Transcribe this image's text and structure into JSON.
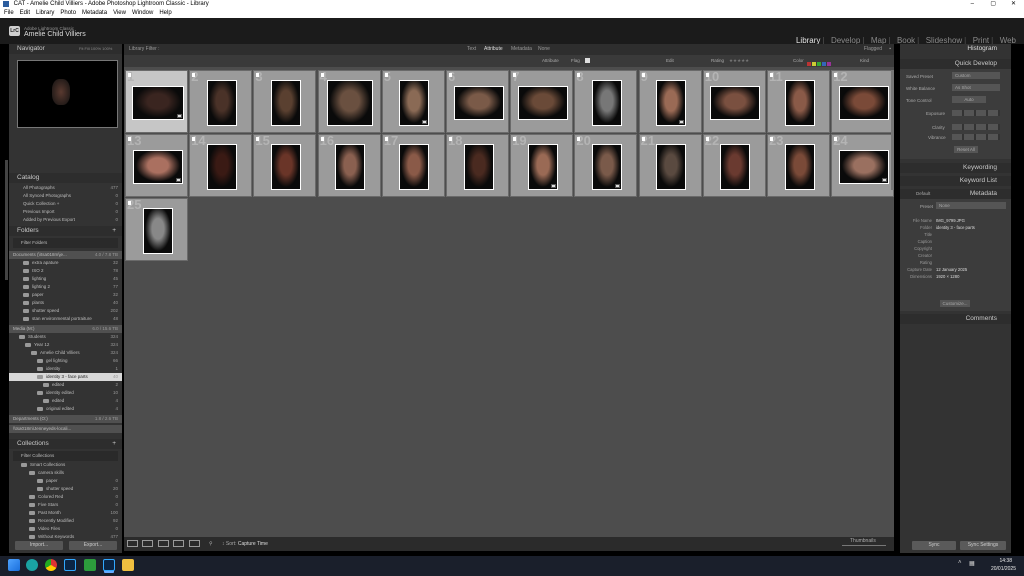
{
  "titlebar": {
    "title": "CAT - Amelie Child Villiers - Adobe Photoshop Lightroom Classic - Library"
  },
  "menu": [
    "File",
    "Edit",
    "Library",
    "Photo",
    "Metadata",
    "View",
    "Window",
    "Help"
  ],
  "identity": {
    "app": "Adobe Lightroom Classic",
    "user": "Amelie Child Villiers"
  },
  "modules": [
    "Library",
    "Develop",
    "Map",
    "Book",
    "Slideshow",
    "Print",
    "Web"
  ],
  "left": {
    "navigator": {
      "title": "Navigator",
      "opts": "Fit  Fill  100%  100%"
    },
    "catalog": {
      "title": "Catalog",
      "items": [
        {
          "label": "All Photographs",
          "count": "477"
        },
        {
          "label": "All Synced Photographs",
          "count": "0"
        },
        {
          "label": "Quick Collection +",
          "count": "0"
        },
        {
          "label": "Previous Import",
          "count": "0"
        },
        {
          "label": "Added by Previous Export",
          "count": "0"
        }
      ]
    },
    "folders": {
      "title": "Folders",
      "filter": "Filter Folders",
      "drive1": "Documents (\\\\tsa018m\\je...",
      "drive1_info": "4.0 / 7.8 TB",
      "items": [
        {
          "label": "extra apature",
          "count": "32"
        },
        {
          "label": "ISO 2",
          "count": "78"
        },
        {
          "label": "lighting",
          "count": "45"
        },
        {
          "label": "lighting 2",
          "count": "77"
        },
        {
          "label": "paper",
          "count": "32"
        },
        {
          "label": "plants",
          "count": "40"
        },
        {
          "label": "shutter speed",
          "count": "202"
        },
        {
          "label": "stan environmental portraiture",
          "count": "48"
        }
      ],
      "drive2": "Media (M:)",
      "drive2_info": "6.0 / 15.6 TB",
      "tree": [
        {
          "label": "Students",
          "count": "324",
          "indent": 1
        },
        {
          "label": "Year 12",
          "count": "324",
          "indent": 2
        },
        {
          "label": "Amelie Child Villiers",
          "count": "324",
          "indent": 3
        },
        {
          "label": "gel lighting",
          "count": "66",
          "indent": 4
        },
        {
          "label": "identity",
          "count": "1",
          "indent": 4
        },
        {
          "label": "identity 3 - face parts",
          "count": "40",
          "indent": 4
        },
        {
          "label": "edited",
          "count": "2",
          "indent": 5
        },
        {
          "label": "identity edited",
          "count": "10",
          "indent": 4
        },
        {
          "label": "edited",
          "count": "4",
          "indent": 5
        },
        {
          "label": "original edited",
          "count": "4",
          "indent": 4
        }
      ],
      "drive3": "Departments (O:)",
      "drive3_info": "1.8 / 2.6 TB",
      "drive4": "\\\\tsa018m\\Jenneyeds-locali..."
    },
    "collections": {
      "title": "Collections",
      "filter": "Filter Collections",
      "items": [
        {
          "label": "Smart Collections",
          "count": "",
          "indent": 1
        },
        {
          "label": "camera skills",
          "count": "",
          "indent": 2
        },
        {
          "label": "paper",
          "count": "0",
          "indent": 3
        },
        {
          "label": "shutter speed",
          "count": "20",
          "indent": 3
        },
        {
          "label": "Colored Red",
          "count": "0",
          "indent": 2
        },
        {
          "label": "Five Stars",
          "count": "0",
          "indent": 2
        },
        {
          "label": "Past Month",
          "count": "100",
          "indent": 2
        },
        {
          "label": "Recently Modified",
          "count": "92",
          "indent": 2
        },
        {
          "label": "Video Files",
          "count": "0",
          "indent": 2
        },
        {
          "label": "Without Keywords",
          "count": "477",
          "indent": 2
        }
      ]
    },
    "import_btn": "Import...",
    "export_btn": "Export..."
  },
  "filterbar": {
    "title": "Library Filter :",
    "tabs": [
      "Text",
      "Attribute",
      "Metadata",
      "None"
    ],
    "preset": "Flagged"
  },
  "attr": {
    "label": "Attribute",
    "flag": "Flag",
    "edit": "Edit",
    "rating": "Rating",
    "color": "Color",
    "kind": "Kind",
    "effect": "Effect"
  },
  "grid": {
    "count": 25,
    "rows": 3,
    "cols": 12
  },
  "toolbar": {
    "sort_label": "Sort:",
    "sort_value": "Capture Time",
    "thumbs_label": "Thumbnails"
  },
  "right": {
    "histogram": "Histogram",
    "quick_develop": "Quick Develop",
    "saved_preset_label": "Saved Preset",
    "saved_preset_value": "Custom",
    "wb_label": "White Balance",
    "wb_value": "As Shot",
    "tone_label": "Tone Control",
    "tone_value": "Auto",
    "exposure": "Exposure",
    "clarity": "Clarity",
    "vibrance": "Vibrance",
    "reset_all": "Reset All",
    "keywording": "Keywording",
    "keyword_list": "Keyword List",
    "metadata": "Metadata",
    "metadata_preset_label": "Preset",
    "metadata_preset_value": "None",
    "meta_default": "Default",
    "fields": [
      {
        "k": "File Name",
        "v": "IMG_9799.JPG"
      },
      {
        "k": "Folder",
        "v": "identity 3 - face parts"
      },
      {
        "k": "Title",
        "v": ""
      },
      {
        "k": "Caption",
        "v": ""
      },
      {
        "k": "Copyright",
        "v": ""
      },
      {
        "k": "Creator",
        "v": ""
      },
      {
        "k": "Rating",
        "v": ""
      },
      {
        "k": "Capture Date",
        "v": "12 January 2025"
      },
      {
        "k": "Dimensions",
        "v": "1920 × 1280"
      }
    ],
    "customize": "Customize...",
    "comments": "Comments",
    "sync": "Sync",
    "sync_settings": "Sync Settings"
  },
  "taskbar": {
    "time": "14:38",
    "date": "20/01/2025"
  },
  "colors": {
    "accent": "#e6e6e6",
    "panel": "#3a3a3a",
    "grid": "#4d4d4d",
    "cell": "#9b9b9b"
  }
}
